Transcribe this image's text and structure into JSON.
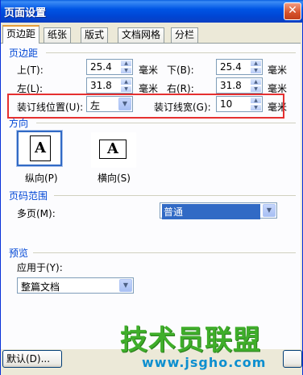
{
  "window": {
    "title": "页面设置",
    "close_glyph": "✕"
  },
  "tabs": [
    {
      "label": "页边距",
      "active": true
    },
    {
      "label": "纸张",
      "active": false
    },
    {
      "label": "版式",
      "active": false
    },
    {
      "label": "文档网格",
      "active": false
    },
    {
      "label": "分栏",
      "active": false
    }
  ],
  "margins": {
    "section_title": "页边距",
    "top": {
      "label": "上(T):",
      "value": "25.4",
      "unit": "毫米"
    },
    "bottom": {
      "label": "下(B):",
      "value": "25.4",
      "unit": "毫米"
    },
    "left": {
      "label": "左(L):",
      "value": "31.8",
      "unit": "毫米"
    },
    "right": {
      "label": "右(R):",
      "value": "31.8",
      "unit": "毫米"
    },
    "gutter_position": {
      "label": "装订线位置(U):",
      "value": "左"
    },
    "gutter": {
      "label": "装订线宽(G):",
      "value": "10",
      "unit": "毫米"
    }
  },
  "orientation": {
    "section_title": "方向",
    "portrait": {
      "label": "纵向(P)",
      "glyph": "A",
      "selected": true
    },
    "landscape": {
      "label": "横向(S)",
      "glyph": "A",
      "selected": false
    }
  },
  "pages": {
    "section_title": "页码范围",
    "multiple_label": "多页(M):",
    "multiple_value": "普通"
  },
  "preview": {
    "section_title": "预览",
    "apply_to_label": "应用于(Y):",
    "apply_to_value": "整篇文档"
  },
  "footer": {
    "default_button": "默认(D)..."
  },
  "watermark": {
    "brand": "技术员联盟",
    "url": "www.jsgho.com"
  },
  "colors": {
    "highlight_box": "#e53030",
    "section_title": "#0046d5",
    "selection": "#316ac5"
  }
}
